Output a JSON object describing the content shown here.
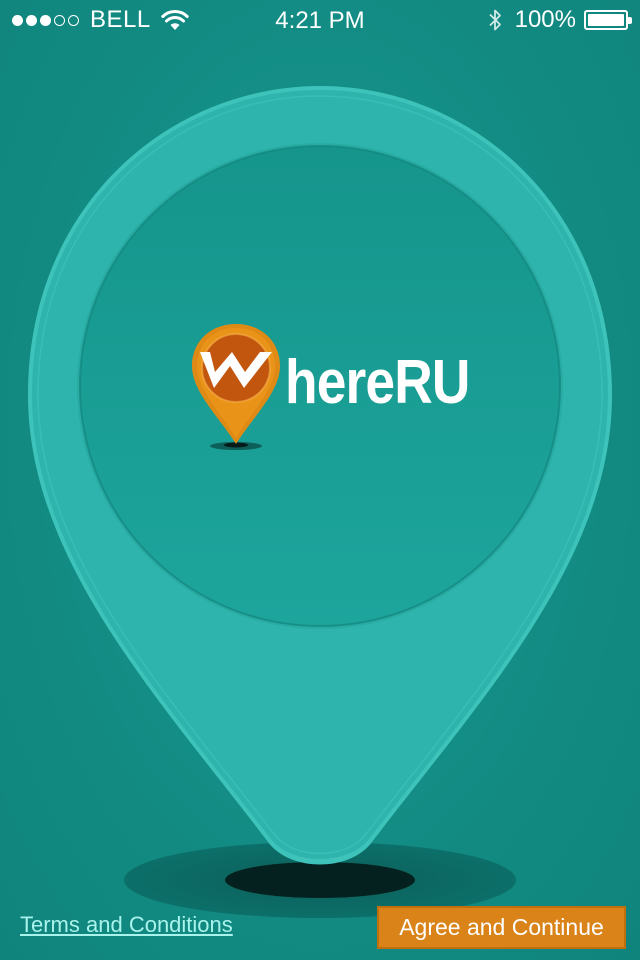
{
  "status_bar": {
    "signal_full": 3,
    "signal_total": 5,
    "carrier": "BELL",
    "time": "4:21 PM",
    "battery_percent": "100%",
    "battery_level": 1.0,
    "icons": [
      "wifi-icon",
      "bluetooth-icon",
      "battery-icon"
    ]
  },
  "logo": {
    "text": "hereRU",
    "mark_letter": "W",
    "icon": "map-pin-icon"
  },
  "footer": {
    "terms_label": "Terms and Conditions",
    "agree_label": "Agree and Continue"
  },
  "colors": {
    "background": "#14938a",
    "pin_outer": "#2fb4ad",
    "pin_inner": "#1a9e95",
    "accent": "#d98318",
    "link": "#a8f3ec"
  }
}
